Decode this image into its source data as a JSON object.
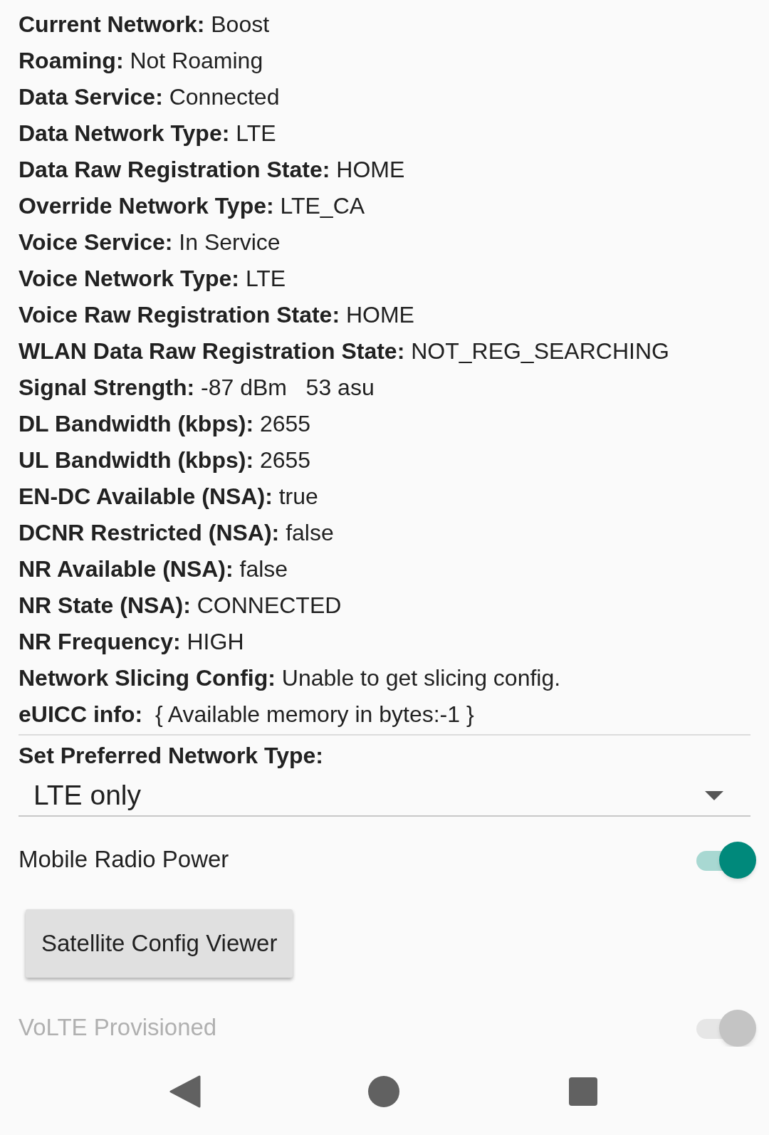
{
  "info_rows": [
    {
      "label": "Current Network:",
      "value": "Boost"
    },
    {
      "label": "Roaming:",
      "value": "Not Roaming"
    },
    {
      "label": "Data Service:",
      "value": "Connected"
    },
    {
      "label": "Data Network Type:",
      "value": "LTE"
    },
    {
      "label": "Data Raw Registration State:",
      "value": "HOME"
    },
    {
      "label": "Override Network Type:",
      "value": "LTE_CA"
    },
    {
      "label": "Voice Service:",
      "value": "In Service"
    },
    {
      "label": "Voice Network Type:",
      "value": "LTE"
    },
    {
      "label": "Voice Raw Registration State:",
      "value": "HOME"
    },
    {
      "label": "WLAN Data Raw Registration State:",
      "value": "NOT_REG_SEARCHING"
    },
    {
      "label": "Signal Strength:",
      "value": "-87 dBm   53 asu"
    },
    {
      "label": "DL Bandwidth (kbps):",
      "value": "2655"
    },
    {
      "label": "UL Bandwidth (kbps):",
      "value": "2655"
    },
    {
      "label": "EN-DC Available (NSA):",
      "value": "true"
    },
    {
      "label": "DCNR Restricted (NSA):",
      "value": "false"
    },
    {
      "label": "NR Available (NSA):",
      "value": "false"
    },
    {
      "label": "NR State (NSA):",
      "value": "CONNECTED"
    },
    {
      "label": "NR Frequency:",
      "value": "HIGH"
    },
    {
      "label": "Network Slicing Config:",
      "value": "Unable to get slicing config."
    },
    {
      "label": "eUICC info:",
      "value": " { Available memory in bytes:-1 }"
    }
  ],
  "preferred_network": {
    "label": "Set Preferred Network Type:",
    "value": "LTE only"
  },
  "toggles": [
    {
      "label": "Mobile Radio Power",
      "on": true,
      "disabled": false
    }
  ],
  "button": "Satellite Config Viewer",
  "toggles_after": [
    {
      "label": "VoLTE Provisioned",
      "on": true,
      "disabled": true
    }
  ]
}
